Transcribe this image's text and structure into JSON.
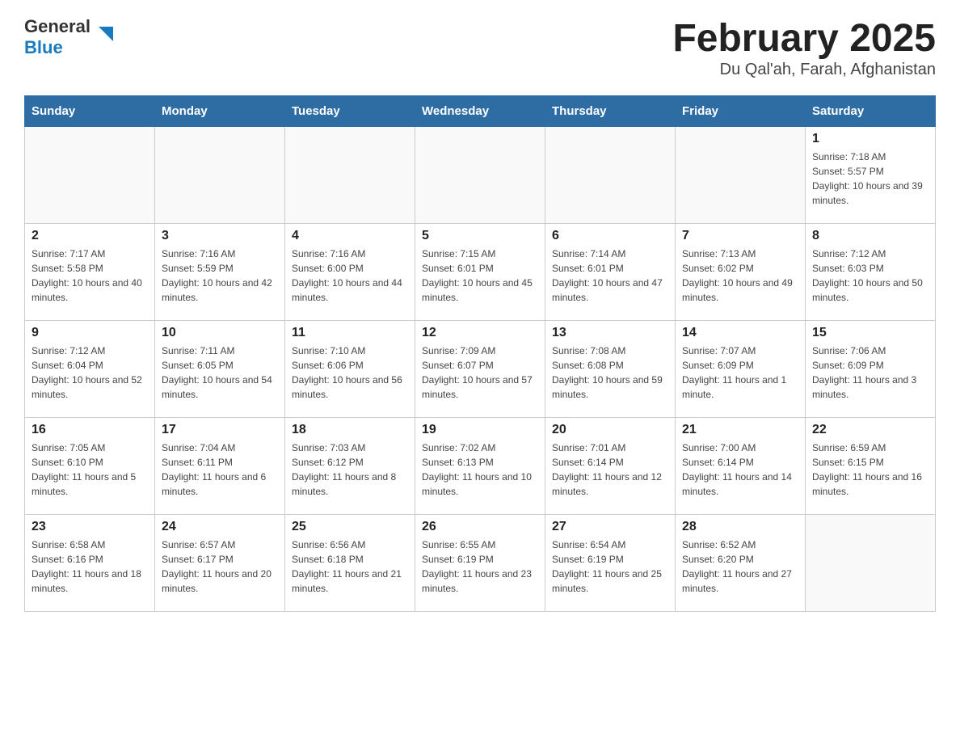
{
  "header": {
    "logo_general": "General",
    "logo_blue": "Blue",
    "month_title": "February 2025",
    "location": "Du Qal'ah, Farah, Afghanistan"
  },
  "days_of_week": [
    "Sunday",
    "Monday",
    "Tuesday",
    "Wednesday",
    "Thursday",
    "Friday",
    "Saturday"
  ],
  "weeks": [
    {
      "days": [
        {
          "num": "",
          "info": ""
        },
        {
          "num": "",
          "info": ""
        },
        {
          "num": "",
          "info": ""
        },
        {
          "num": "",
          "info": ""
        },
        {
          "num": "",
          "info": ""
        },
        {
          "num": "",
          "info": ""
        },
        {
          "num": "1",
          "info": "Sunrise: 7:18 AM\nSunset: 5:57 PM\nDaylight: 10 hours and 39 minutes."
        }
      ]
    },
    {
      "days": [
        {
          "num": "2",
          "info": "Sunrise: 7:17 AM\nSunset: 5:58 PM\nDaylight: 10 hours and 40 minutes."
        },
        {
          "num": "3",
          "info": "Sunrise: 7:16 AM\nSunset: 5:59 PM\nDaylight: 10 hours and 42 minutes."
        },
        {
          "num": "4",
          "info": "Sunrise: 7:16 AM\nSunset: 6:00 PM\nDaylight: 10 hours and 44 minutes."
        },
        {
          "num": "5",
          "info": "Sunrise: 7:15 AM\nSunset: 6:01 PM\nDaylight: 10 hours and 45 minutes."
        },
        {
          "num": "6",
          "info": "Sunrise: 7:14 AM\nSunset: 6:01 PM\nDaylight: 10 hours and 47 minutes."
        },
        {
          "num": "7",
          "info": "Sunrise: 7:13 AM\nSunset: 6:02 PM\nDaylight: 10 hours and 49 minutes."
        },
        {
          "num": "8",
          "info": "Sunrise: 7:12 AM\nSunset: 6:03 PM\nDaylight: 10 hours and 50 minutes."
        }
      ]
    },
    {
      "days": [
        {
          "num": "9",
          "info": "Sunrise: 7:12 AM\nSunset: 6:04 PM\nDaylight: 10 hours and 52 minutes."
        },
        {
          "num": "10",
          "info": "Sunrise: 7:11 AM\nSunset: 6:05 PM\nDaylight: 10 hours and 54 minutes."
        },
        {
          "num": "11",
          "info": "Sunrise: 7:10 AM\nSunset: 6:06 PM\nDaylight: 10 hours and 56 minutes."
        },
        {
          "num": "12",
          "info": "Sunrise: 7:09 AM\nSunset: 6:07 PM\nDaylight: 10 hours and 57 minutes."
        },
        {
          "num": "13",
          "info": "Sunrise: 7:08 AM\nSunset: 6:08 PM\nDaylight: 10 hours and 59 minutes."
        },
        {
          "num": "14",
          "info": "Sunrise: 7:07 AM\nSunset: 6:09 PM\nDaylight: 11 hours and 1 minute."
        },
        {
          "num": "15",
          "info": "Sunrise: 7:06 AM\nSunset: 6:09 PM\nDaylight: 11 hours and 3 minutes."
        }
      ]
    },
    {
      "days": [
        {
          "num": "16",
          "info": "Sunrise: 7:05 AM\nSunset: 6:10 PM\nDaylight: 11 hours and 5 minutes."
        },
        {
          "num": "17",
          "info": "Sunrise: 7:04 AM\nSunset: 6:11 PM\nDaylight: 11 hours and 6 minutes."
        },
        {
          "num": "18",
          "info": "Sunrise: 7:03 AM\nSunset: 6:12 PM\nDaylight: 11 hours and 8 minutes."
        },
        {
          "num": "19",
          "info": "Sunrise: 7:02 AM\nSunset: 6:13 PM\nDaylight: 11 hours and 10 minutes."
        },
        {
          "num": "20",
          "info": "Sunrise: 7:01 AM\nSunset: 6:14 PM\nDaylight: 11 hours and 12 minutes."
        },
        {
          "num": "21",
          "info": "Sunrise: 7:00 AM\nSunset: 6:14 PM\nDaylight: 11 hours and 14 minutes."
        },
        {
          "num": "22",
          "info": "Sunrise: 6:59 AM\nSunset: 6:15 PM\nDaylight: 11 hours and 16 minutes."
        }
      ]
    },
    {
      "days": [
        {
          "num": "23",
          "info": "Sunrise: 6:58 AM\nSunset: 6:16 PM\nDaylight: 11 hours and 18 minutes."
        },
        {
          "num": "24",
          "info": "Sunrise: 6:57 AM\nSunset: 6:17 PM\nDaylight: 11 hours and 20 minutes."
        },
        {
          "num": "25",
          "info": "Sunrise: 6:56 AM\nSunset: 6:18 PM\nDaylight: 11 hours and 21 minutes."
        },
        {
          "num": "26",
          "info": "Sunrise: 6:55 AM\nSunset: 6:19 PM\nDaylight: 11 hours and 23 minutes."
        },
        {
          "num": "27",
          "info": "Sunrise: 6:54 AM\nSunset: 6:19 PM\nDaylight: 11 hours and 25 minutes."
        },
        {
          "num": "28",
          "info": "Sunrise: 6:52 AM\nSunset: 6:20 PM\nDaylight: 11 hours and 27 minutes."
        },
        {
          "num": "",
          "info": ""
        }
      ]
    }
  ]
}
